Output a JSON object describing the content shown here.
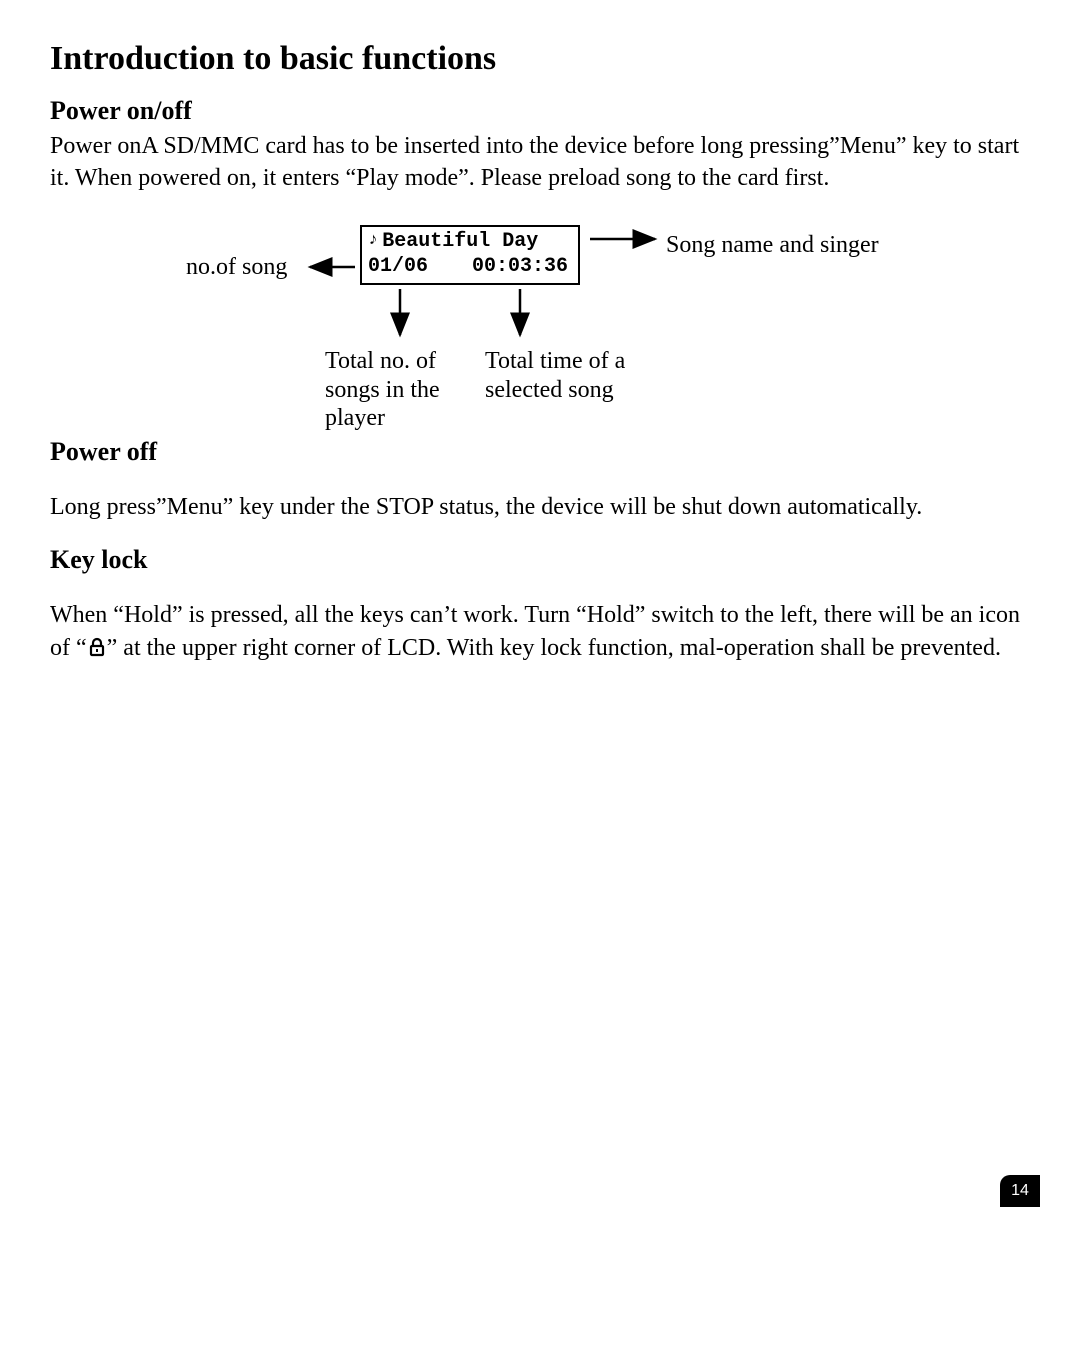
{
  "title": "Introduction to basic functions",
  "sections": {
    "power_on_off": {
      "heading": "Power on/off",
      "body": "Power onA SD/MMC card has to be inserted into the device before long pressing”Menu” key to start it. When powered on, it enters “Play mode”. Please preload song to the card first."
    },
    "power_off": {
      "heading": "Power off",
      "body": "Long press”Menu” key under the STOP status, the device will be shut down automatically."
    },
    "key_lock": {
      "heading": "Key lock",
      "body_before": "When “Hold” is pressed, all the keys can’t work. Turn “Hold” switch to the left, there will be an icon of “",
      "body_after": "” at the upper right corner of LCD. With key lock function, mal-operation shall be prevented."
    }
  },
  "diagram": {
    "lcd": {
      "song_title": "Beautiful Day",
      "track_counter": "01/06",
      "time": "00:03:36"
    },
    "labels": {
      "no_of_song": "no.of song",
      "song_name_singer": "Song name and singer",
      "total_songs": "Total no. of songs in the player",
      "total_time": "Total time of a selected song"
    }
  },
  "page_number": "14"
}
